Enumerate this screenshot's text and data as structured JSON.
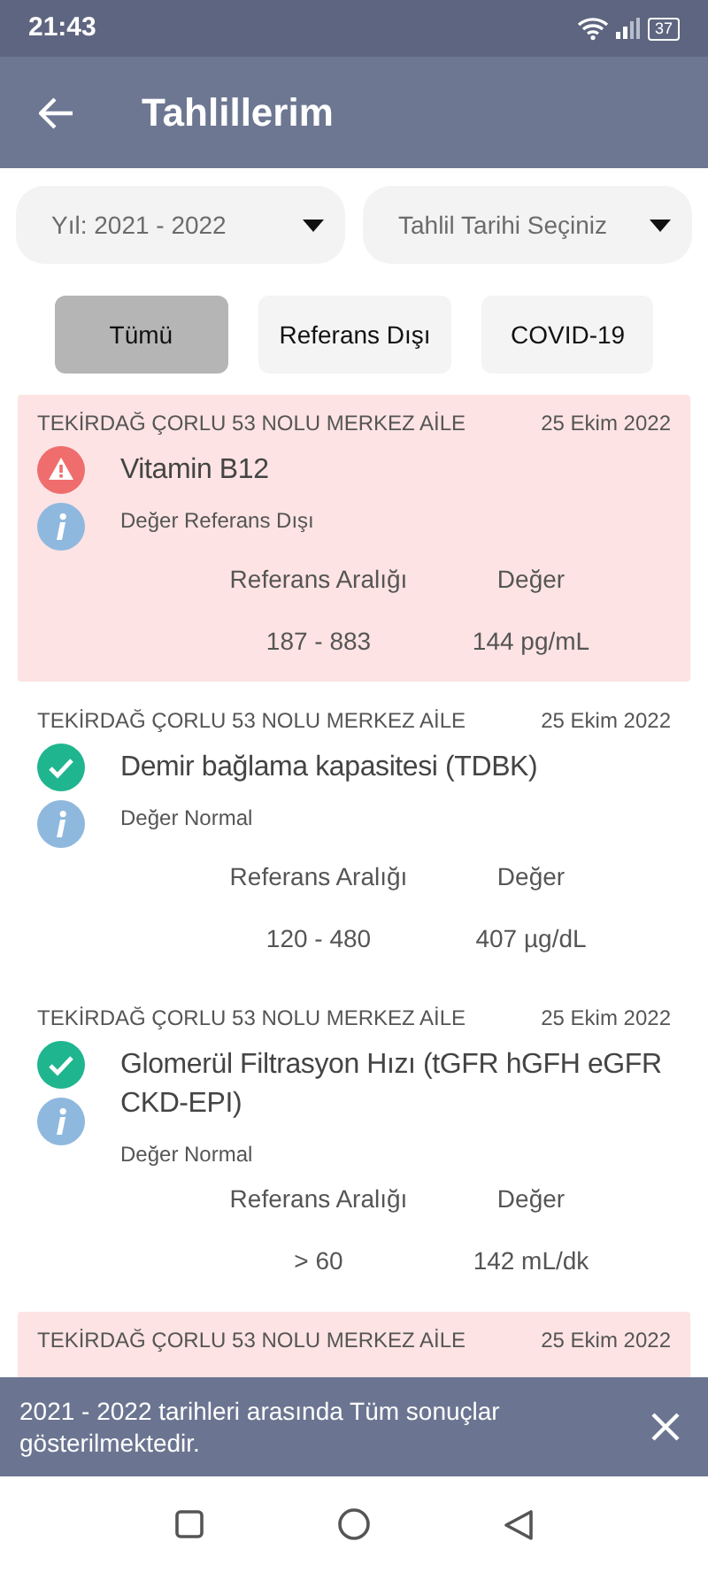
{
  "status_bar": {
    "time": "21:43",
    "battery": "37"
  },
  "app_bar": {
    "title": "Tahlillerim"
  },
  "dropdowns": [
    {
      "value": "Yıl: 2021 - 2022"
    },
    {
      "placeholder": "Tahlil Tarihi Seçiniz"
    }
  ],
  "filters": [
    {
      "label": "Tümü",
      "selected": true
    },
    {
      "label": "Referans Dışı",
      "selected": false
    },
    {
      "label": "COVID-19",
      "selected": false
    }
  ],
  "results": [
    {
      "kind": "abnormal",
      "institution": "TEKİRDAĞ ÇORLU 53 NOLU MERKEZ AİLE",
      "date": "25 Ekim 2022",
      "test": "Vitamin B12",
      "status": "Değer Referans Dışı",
      "range_label": "Referans Aralığı",
      "value_label": "Değer",
      "range": "187 - 883",
      "value": "144 pg/mL"
    },
    {
      "kind": "normal",
      "institution": "TEKİRDAĞ ÇORLU 53 NOLU MERKEZ AİLE",
      "date": "25 Ekim 2022",
      "test": "Demir bağlama kapasitesi (TDBK)",
      "status": "Değer Normal",
      "range_label": "Referans Aralığı",
      "value_label": "Değer",
      "range": "120 - 480",
      "value": "407 µg/dL"
    },
    {
      "kind": "normal",
      "institution": "TEKİRDAĞ ÇORLU 53 NOLU MERKEZ AİLE",
      "date": "25 Ekim 2022",
      "test": "Glomerül Filtrasyon Hızı (tGFR hGFH eGFR CKD-EPI)",
      "status": "Değer Normal",
      "range_label": "Referans Aralığı",
      "value_label": "Değer",
      "range": "> 60",
      "value": "142 mL/dk"
    },
    {
      "kind": "abnormal",
      "institution": "TEKİRDAĞ ÇORLU 53 NOLU MERKEZ AİLE",
      "date": "25 Ekim 2022"
    }
  ],
  "snackbar": {
    "message": "2021 - 2022 tarihleri arasında Tüm sonuçlar gösterilmektedir."
  }
}
